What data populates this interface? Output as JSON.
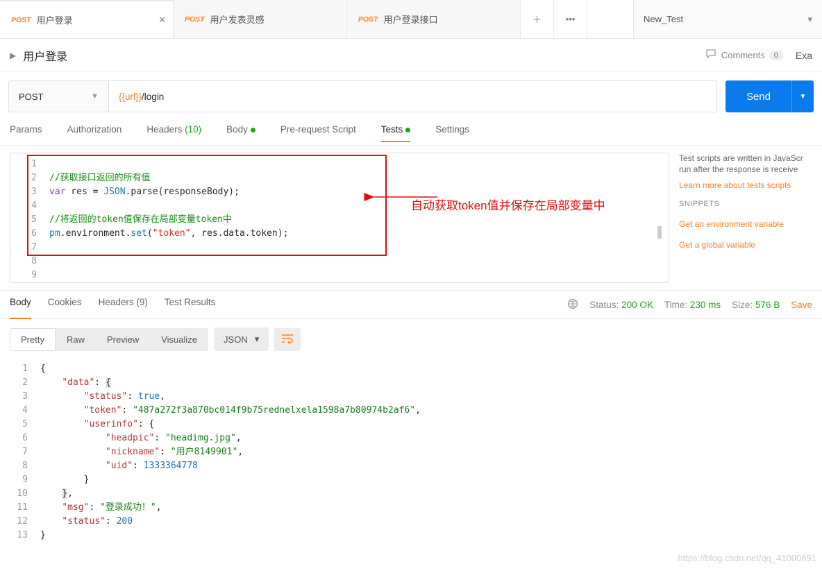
{
  "tabs": [
    {
      "method": "POST",
      "title": "用户登录",
      "active": true
    },
    {
      "method": "POST",
      "title": "用户发表灵感",
      "active": false
    },
    {
      "method": "POST",
      "title": "用户登录接口",
      "active": false
    }
  ],
  "env": "New_Test",
  "breadcrumb": "用户登录",
  "comments": {
    "label": "Comments",
    "count": "0"
  },
  "examples_label": "Exa",
  "request": {
    "method": "POST",
    "url_var": "{{url}}",
    "url_path": "/login",
    "send": "Send"
  },
  "req_tabs": {
    "params": "Params",
    "auth": "Authorization",
    "headers": "Headers",
    "headers_count": "(10)",
    "body": "Body",
    "prereq": "Pre-request Script",
    "tests": "Tests",
    "settings": "Settings"
  },
  "test_code": {
    "l2": "//获取接口返回的所有值",
    "l3_var": "var",
    "l3_rest": " res = ",
    "l3_json": "JSON",
    "l3_call": ".parse(responseBody);",
    "l5": "//将返回的token值保存在局部变量token中",
    "l6_pm": "pm",
    "l6_env": ".environment.",
    "l6_set": "set",
    "l6_open": "(",
    "l6_str": "\"token\"",
    "l6_rest": ", res.data.token);"
  },
  "annotation": "自动获取token值并保存在局部变量中",
  "side": {
    "desc1": "Test scripts are written in JavaScr",
    "desc2": "run after the response is receive",
    "link": "Learn more about tests scripts",
    "head": "SNIPPETS",
    "i1": "Get an environment variable",
    "i2": "Get a global variable"
  },
  "resp_tabs": {
    "body": "Body",
    "cookies": "Cookies",
    "headers": "Headers",
    "headers_count": "(9)",
    "tests": "Test Results"
  },
  "resp_meta": {
    "status_l": "Status:",
    "status_v": "200 OK",
    "time_l": "Time:",
    "time_v": "230 ms",
    "size_l": "Size:",
    "size_v": "576 B",
    "save": "Save"
  },
  "resp_toolbar": {
    "pretty": "Pretty",
    "raw": "Raw",
    "preview": "Preview",
    "visualize": "Visualize",
    "format": "JSON"
  },
  "response_json": {
    "data_key": "\"data\"",
    "status_key": "\"status\"",
    "status_val": "true",
    "token_key": "\"token\"",
    "token_val": "\"487a272f3a870bc014f9b75rednelxela1598a7b80974b2af6\"",
    "userinfo_key": "\"userinfo\"",
    "headpic_key": "\"headpic\"",
    "headpic_val": "\"headimg.jpg\"",
    "nickname_key": "\"nickname\"",
    "nickname_val": "\"用户8149901\"",
    "uid_key": "\"uid\"",
    "uid_val": "1333364778",
    "msg_key": "\"msg\"",
    "msg_val": "\"登录成功！\"",
    "status2_key": "\"status\"",
    "status2_val": "200"
  },
  "watermark": "https://blog.csdn.net/qq_41000891"
}
